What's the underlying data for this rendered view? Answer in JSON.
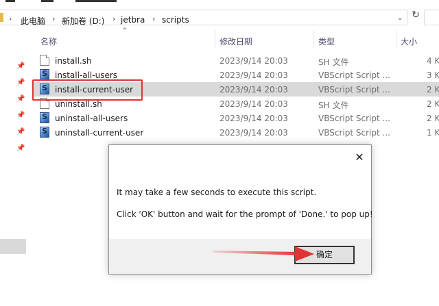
{
  "address_bar": {
    "breadcrumbs": [
      "此电脑",
      "新加卷 (D:)",
      "jetbra",
      "scripts"
    ]
  },
  "columns": {
    "name": "名称",
    "date": "修改日期",
    "type": "类型",
    "size": "大小"
  },
  "files": [
    {
      "name": "install.sh",
      "date": "2023/9/14 20:03",
      "type": "SH 文件",
      "size": "4 K",
      "icon": "sh-file-icon"
    },
    {
      "name": "install-all-users",
      "date": "2023/9/14 20:03",
      "type": "VBScript Script ...",
      "size": "3 K",
      "icon": "vbscript-file-icon"
    },
    {
      "name": "install-current-user",
      "date": "2023/9/14 20:03",
      "type": "VBScript Script ...",
      "size": "2 K",
      "icon": "vbscript-file-icon"
    },
    {
      "name": "uninstall.sh",
      "date": "2023/9/14 20:03",
      "type": "SH 文件",
      "size": "2 K",
      "icon": "sh-file-icon"
    },
    {
      "name": "uninstall-all-users",
      "date": "2023/9/14 20:03",
      "type": "VBScript Script ...",
      "size": "2 K",
      "icon": "vbscript-file-icon"
    },
    {
      "name": "uninstall-current-user",
      "date": "2023/9/14 20:03",
      "type": "VBScript Script ...",
      "size": "1 K",
      "icon": "vbscript-file-icon"
    }
  ],
  "dialog": {
    "message_line1": "It may take a few seconds to execute this script.",
    "message_line2": "Click 'OK' button and wait for the prompt of 'Done.' to pop up!",
    "close_label": "✕",
    "ok_label": "确定"
  },
  "colors": {
    "highlight": "#e03434",
    "selected_row": "#d9d9d9",
    "annotation_arrow": "#e03434"
  }
}
